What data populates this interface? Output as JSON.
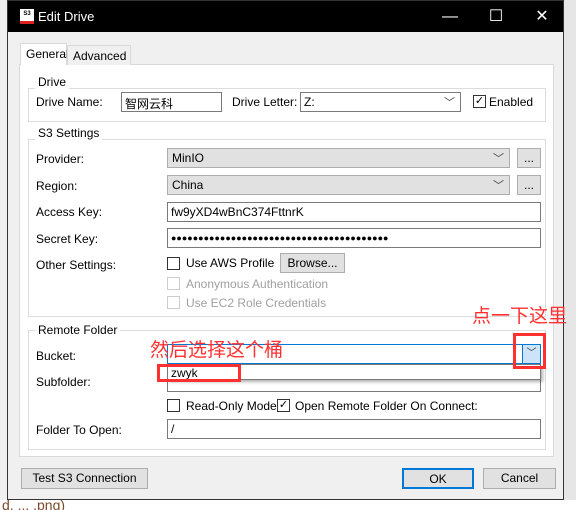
{
  "window": {
    "title": "Edit Drive",
    "minimize": "—",
    "maximize": "☐",
    "close": "✕",
    "icon": "S3"
  },
  "tabs": [
    {
      "label": "General",
      "active": true
    },
    {
      "label": "Advanced",
      "active": false
    }
  ],
  "drive": {
    "group": "Drive",
    "name_label": "Drive Name:",
    "name_value": "智网云科",
    "letter_label": "Drive Letter:",
    "letter_value": "Z:",
    "enabled_label": "Enabled",
    "enabled": true
  },
  "s3": {
    "group": "S3 Settings",
    "provider_label": "Provider:",
    "provider_value": "MinIO",
    "region_label": "Region:",
    "region_value": "China",
    "more_label": "...",
    "access_key_label": "Access Key:",
    "access_key_value": "fw9yXD4wBnC374FttnrK",
    "secret_key_label": "Secret Key:",
    "secret_key_value": "●●●●●●●●●●●●●●●●●●●●●●●●●●●●●●●●●●●●●●●●",
    "other_label": "Other Settings:",
    "use_aws_profile": "Use AWS Profile",
    "use_aws_profile_checked": false,
    "browse_label": "Browse...",
    "anonymous_auth": "Anonymous Authentication",
    "ec2_role": "Use EC2 Role Credentials"
  },
  "remote": {
    "group": "Remote Folder",
    "bucket_label": "Bucket:",
    "bucket_value": "",
    "bucket_options": [
      "zwyk"
    ],
    "subfolder_label": "Subfolder:",
    "subfolder_value": "",
    "read_only_label": "Read-Only Mode",
    "read_only": false,
    "open_remote_label": "Open Remote Folder On Connect:",
    "open_remote": true,
    "folder_label": "Folder To Open:",
    "folder_value": "/"
  },
  "buttons": {
    "test": "Test S3 Connection",
    "ok": "OK",
    "cancel": "Cancel"
  },
  "annotations": {
    "click_here": "点一下这里",
    "select_bucket": "然后选择这个桶",
    "color": "#ff3030"
  },
  "background": {
    "bottom_text": "d, ... .png)"
  }
}
